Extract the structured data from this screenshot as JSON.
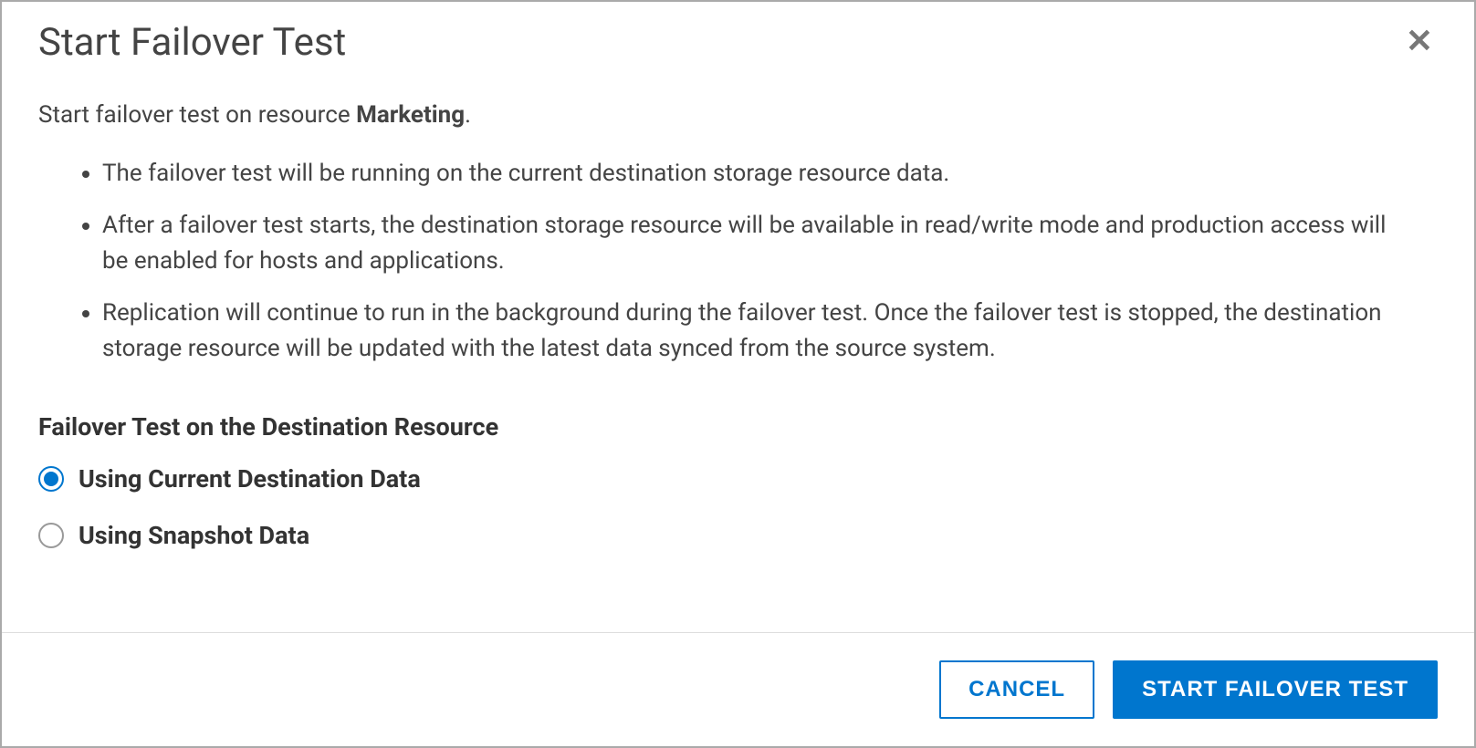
{
  "dialog": {
    "title": "Start Failover Test",
    "intro_prefix": "Start failover test on resource ",
    "resource_name": "Marketing",
    "intro_suffix": ".",
    "bullets": [
      "The failover test will be running on the current destination storage resource data.",
      "After a failover test starts, the destination storage resource will be available in read/write mode and production access will be enabled for hosts and applications.",
      "Replication will continue to run in the background during the failover test. Once the failover test is stopped, the destination storage resource will be updated with the latest data synced from the source system."
    ],
    "section_title": "Failover Test on the Destination Resource",
    "radio_options": [
      {
        "label": "Using Current Destination Data",
        "selected": true
      },
      {
        "label": "Using Snapshot Data",
        "selected": false
      }
    ],
    "buttons": {
      "cancel": "CANCEL",
      "confirm": "START FAILOVER TEST"
    }
  }
}
